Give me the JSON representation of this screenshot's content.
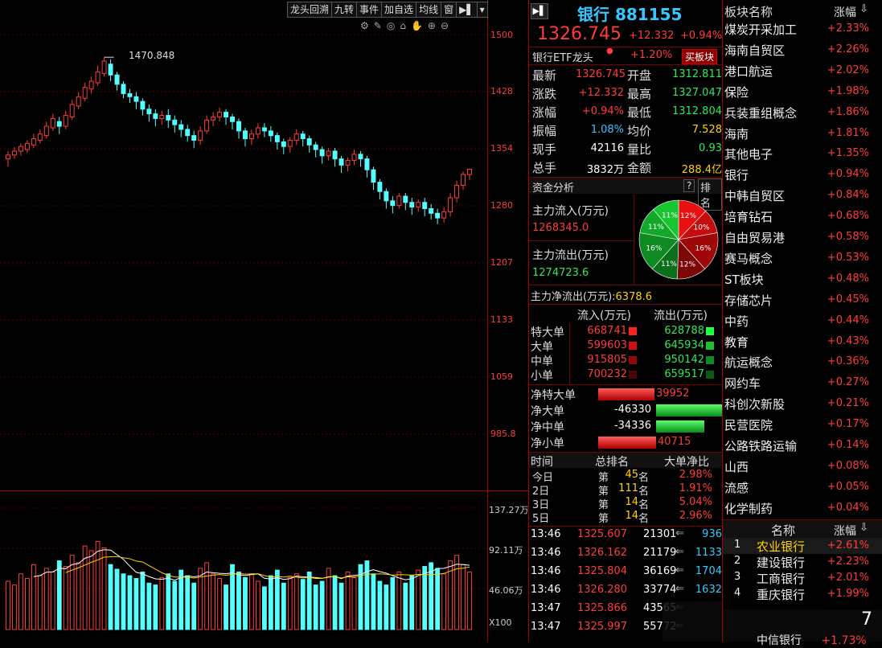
{
  "toolbar": {
    "items": [
      "龙头回溯",
      "九转",
      "事件",
      "加自选",
      "均线",
      "窗"
    ]
  },
  "chart": {
    "peak_label": "1470.848",
    "price_ticks": [
      "1500",
      "1428",
      "1354",
      "1280",
      "1207",
      "1133",
      "1059",
      "985.8"
    ],
    "volume_ticks": [
      "137.27万",
      "92.11万",
      "46.06万"
    ],
    "volume_unit": "X100"
  },
  "chart_data": {
    "type": "candlestick",
    "ylim": [
      985.8,
      1500
    ],
    "candles": [
      [
        1340,
        1345,
        1330,
        1350
      ],
      [
        1345,
        1350,
        1340,
        1355
      ],
      [
        1350,
        1356,
        1344,
        1360
      ],
      [
        1352,
        1360,
        1348,
        1364
      ],
      [
        1358,
        1366,
        1354,
        1372
      ],
      [
        1364,
        1372,
        1360,
        1378
      ],
      [
        1370,
        1382,
        1366,
        1388
      ],
      [
        1380,
        1392,
        1376,
        1398
      ],
      [
        1388,
        1382,
        1372,
        1394
      ],
      [
        1382,
        1396,
        1378,
        1402
      ],
      [
        1394,
        1410,
        1390,
        1416
      ],
      [
        1408,
        1420,
        1404,
        1426
      ],
      [
        1418,
        1432,
        1414,
        1438
      ],
      [
        1430,
        1440,
        1424,
        1446
      ],
      [
        1438,
        1452,
        1434,
        1460
      ],
      [
        1450,
        1466,
        1446,
        1470.848
      ],
      [
        1462,
        1448,
        1440,
        1468
      ],
      [
        1448,
        1436,
        1428,
        1452
      ],
      [
        1436,
        1424,
        1418,
        1440
      ],
      [
        1424,
        1420,
        1412,
        1430
      ],
      [
        1420,
        1414,
        1404,
        1426
      ],
      [
        1414,
        1404,
        1396,
        1418
      ],
      [
        1404,
        1398,
        1388,
        1410
      ],
      [
        1398,
        1392,
        1382,
        1404
      ],
      [
        1392,
        1396,
        1384,
        1402
      ],
      [
        1396,
        1390,
        1380,
        1404
      ],
      [
        1390,
        1384,
        1374,
        1396
      ],
      [
        1384,
        1378,
        1368,
        1390
      ],
      [
        1378,
        1370,
        1362,
        1384
      ],
      [
        1370,
        1364,
        1354,
        1376
      ],
      [
        1364,
        1376,
        1358,
        1382
      ],
      [
        1376,
        1390,
        1372,
        1396
      ],
      [
        1390,
        1394,
        1382,
        1400
      ],
      [
        1394,
        1400,
        1388,
        1406
      ],
      [
        1400,
        1394,
        1384,
        1404
      ],
      [
        1394,
        1388,
        1378,
        1398
      ],
      [
        1388,
        1376,
        1366,
        1392
      ],
      [
        1376,
        1366,
        1356,
        1380
      ],
      [
        1366,
        1372,
        1358,
        1378
      ],
      [
        1372,
        1380,
        1366,
        1386
      ],
      [
        1380,
        1376,
        1368,
        1386
      ],
      [
        1376,
        1370,
        1362,
        1382
      ],
      [
        1370,
        1362,
        1352,
        1374
      ],
      [
        1362,
        1356,
        1346,
        1366
      ],
      [
        1356,
        1364,
        1348,
        1368
      ],
      [
        1364,
        1372,
        1358,
        1378
      ],
      [
        1372,
        1366,
        1356,
        1376
      ],
      [
        1366,
        1358,
        1348,
        1370
      ],
      [
        1358,
        1352,
        1342,
        1362
      ],
      [
        1352,
        1344,
        1334,
        1356
      ],
      [
        1344,
        1350,
        1338,
        1354
      ],
      [
        1350,
        1340,
        1330,
        1354
      ],
      [
        1340,
        1332,
        1322,
        1344
      ],
      [
        1332,
        1338,
        1324,
        1342
      ],
      [
        1338,
        1346,
        1332,
        1352
      ],
      [
        1346,
        1340,
        1330,
        1350
      ],
      [
        1340,
        1326,
        1316,
        1344
      ],
      [
        1326,
        1310,
        1300,
        1330
      ],
      [
        1310,
        1298,
        1288,
        1314
      ],
      [
        1298,
        1286,
        1276,
        1302
      ],
      [
        1286,
        1280,
        1270,
        1292
      ],
      [
        1280,
        1292,
        1276,
        1296
      ],
      [
        1292,
        1284,
        1274,
        1296
      ],
      [
        1284,
        1278,
        1268,
        1290
      ],
      [
        1278,
        1284,
        1272,
        1288
      ],
      [
        1284,
        1276,
        1266,
        1290
      ],
      [
        1276,
        1270,
        1262,
        1282
      ],
      [
        1270,
        1264,
        1256,
        1276
      ],
      [
        1264,
        1272,
        1258,
        1278
      ],
      [
        1272,
        1290,
        1266,
        1296
      ],
      [
        1290,
        1306,
        1284,
        1312
      ],
      [
        1306,
        1320,
        1300,
        1324
      ],
      [
        1320,
        1326.745,
        1312.804,
        1327.047
      ]
    ],
    "volumes": [
      52,
      48,
      60,
      55,
      70,
      58,
      66,
      62,
      74,
      68,
      80,
      72,
      90,
      85,
      95,
      88,
      70,
      65,
      60,
      58,
      55,
      62,
      50,
      48,
      56,
      60,
      52,
      64,
      58,
      50,
      66,
      72,
      60,
      55,
      48,
      70,
      62,
      56,
      60,
      52,
      46,
      58,
      64,
      50,
      56,
      60,
      54,
      62,
      48,
      52,
      66,
      58,
      50,
      62,
      56,
      70,
      74,
      60,
      52,
      48,
      56,
      62,
      50,
      58,
      64,
      68,
      72,
      66,
      60,
      74,
      80,
      70,
      62
    ]
  },
  "quote": {
    "title": "银行 881155",
    "price": "1326.745",
    "change": "+12.332",
    "change_pct": "+0.94%",
    "etf_label": "银行ETF龙头",
    "etf_pct": "+1.20%",
    "buy_btn": "买板块",
    "fields": [
      {
        "l1": "最新",
        "v1": "1326.745",
        "l2": "开盘",
        "v2": "1312.811"
      },
      {
        "l1": "涨跌",
        "v1": "+12.332",
        "l2": "最高",
        "v2": "1327.047"
      },
      {
        "l1": "涨幅",
        "v1": "+0.94%",
        "l2": "最低",
        "v2": "1312.804"
      },
      {
        "l1": "振幅",
        "v1": "1.08%",
        "l2": "均价",
        "v2": "7.528"
      },
      {
        "l1": "现手",
        "v1": "42116",
        "l2": "量比",
        "v2": "0.93"
      },
      {
        "l1": "总手",
        "v1": "3832万",
        "l2": "金额",
        "v2": "288.4亿"
      }
    ]
  },
  "capital": {
    "title": "资金分析",
    "help": "?",
    "rank_btn": "排名",
    "inflow_label": "主力流入(万元)",
    "inflow_value": "1268345.0",
    "outflow_label": "主力流出(万元)",
    "outflow_value": "1274723.6",
    "net_label": "主力净流出(万元):",
    "net_value": "6378.6",
    "pie": [
      {
        "label": "12%",
        "value": 12,
        "color": "#e81010"
      },
      {
        "label": "10%",
        "value": 10,
        "color": "#c40c0c"
      },
      {
        "label": "16%",
        "value": 16,
        "color": "#a00808"
      },
      {
        "label": "12%",
        "value": 12,
        "color": "#7a0606"
      },
      {
        "label": "11%",
        "value": 11,
        "color": "#0a6e1a"
      },
      {
        "label": "16%",
        "value": 16,
        "color": "#0e8a22"
      },
      {
        "label": "11%",
        "value": 11,
        "color": "#12a82a"
      },
      {
        "label": "11%",
        "value": 11,
        "color": "#18c632"
      }
    ],
    "flow_header": [
      "流入(万元)",
      "流出(万元)"
    ],
    "flows": [
      {
        "name": "特大单",
        "in": "668741",
        "out": "628788",
        "inc": "#ff2020",
        "outc": "#20ff40"
      },
      {
        "name": "大单",
        "in": "599603",
        "out": "645934",
        "inc": "#d01010",
        "outc": "#18c032"
      },
      {
        "name": "中单",
        "in": "915805",
        "out": "950142",
        "inc": "#8a0a0a",
        "outc": "#108a22"
      },
      {
        "name": "小单",
        "in": "700232",
        "out": "659517",
        "inc": "#4a0505",
        "outc": "#0a5a16"
      }
    ],
    "nets": [
      {
        "name": "净特大单",
        "value": "39952",
        "dir": "pos",
        "width": 70
      },
      {
        "name": "净大单",
        "value": "-46330",
        "dir": "neg",
        "width": 82
      },
      {
        "name": "净中单",
        "value": "-34336",
        "dir": "neg",
        "width": 60
      },
      {
        "name": "净小单",
        "value": "40715",
        "dir": "pos",
        "width": 72
      }
    ],
    "rank_header": [
      "时间",
      "总排名",
      "大单净比"
    ],
    "ranks": [
      {
        "t": "今日",
        "pre": "第",
        "n": "45",
        "suf": "名",
        "r": "2.98%"
      },
      {
        "t": "2日",
        "pre": "第",
        "n": "111",
        "suf": "名",
        "r": "1.91%"
      },
      {
        "t": "3日",
        "pre": "第",
        "n": "14",
        "suf": "名",
        "r": "5.04%"
      },
      {
        "t": "5日",
        "pre": "第",
        "n": "14",
        "suf": "名",
        "r": "2.96%"
      }
    ]
  },
  "ticks": [
    {
      "t": "13:46",
      "p": "1325.607",
      "v": "21301",
      "n": "936"
    },
    {
      "t": "13:46",
      "p": "1326.162",
      "v": "21179",
      "n": "1133"
    },
    {
      "t": "13:46",
      "p": "1325.804",
      "v": "36169",
      "n": "1704"
    },
    {
      "t": "13:46",
      "p": "1326.280",
      "v": "33774",
      "n": "1632"
    },
    {
      "t": "13:47",
      "p": "1325.866",
      "v": "43565",
      "n": ""
    },
    {
      "t": "13:47",
      "p": "1325.997",
      "v": "55772",
      "n": ""
    }
  ],
  "sectors": {
    "header_name": "板块名称",
    "header_pct": "涨幅",
    "items": [
      {
        "name": "煤炭开采加工",
        "pct": "+2.33%"
      },
      {
        "name": "海南自贸区",
        "pct": "+2.26%"
      },
      {
        "name": "港口航运",
        "pct": "+2.02%"
      },
      {
        "name": "保险",
        "pct": "+1.98%"
      },
      {
        "name": "兵装重组概念",
        "pct": "+1.86%"
      },
      {
        "name": "海南",
        "pct": "+1.81%"
      },
      {
        "name": "其他电子",
        "pct": "+1.35%"
      },
      {
        "name": "银行",
        "pct": "+0.94%"
      },
      {
        "name": "中韩自贸区",
        "pct": "+0.84%"
      },
      {
        "name": "培育钻石",
        "pct": "+0.68%"
      },
      {
        "name": "自由贸易港",
        "pct": "+0.58%"
      },
      {
        "name": "赛马概念",
        "pct": "+0.53%"
      },
      {
        "name": "ST板块",
        "pct": "+0.48%"
      },
      {
        "name": "存储芯片",
        "pct": "+0.45%"
      },
      {
        "name": "中药",
        "pct": "+0.44%"
      },
      {
        "name": "教育",
        "pct": "+0.43%"
      },
      {
        "name": "航运概念",
        "pct": "+0.36%"
      },
      {
        "name": "网约车",
        "pct": "+0.27%"
      },
      {
        "name": "科创次新股",
        "pct": "+0.21%"
      },
      {
        "name": "民营医院",
        "pct": "+0.17%"
      },
      {
        "name": "公路铁路运输",
        "pct": "+0.14%"
      },
      {
        "name": "山西",
        "pct": "+0.08%"
      },
      {
        "name": "流感",
        "pct": "+0.05%"
      },
      {
        "name": "化学制药",
        "pct": "+0.04%"
      }
    ]
  },
  "stocks": {
    "header_name": "名称",
    "header_pct": "涨幅",
    "items": [
      {
        "idx": "1",
        "name": "农业银行",
        "pct": "+2.61%"
      },
      {
        "idx": "2",
        "name": "建设银行",
        "pct": "+2.23%"
      },
      {
        "idx": "3",
        "name": "工商银行",
        "pct": "+2.01%"
      },
      {
        "idx": "4",
        "name": "重庆银行",
        "pct": "+1.99%"
      }
    ],
    "partial": {
      "idx": "7",
      "name": "中信银行",
      "pct": "+1.73%"
    }
  },
  "colors": {
    "up": "#ff3c3c",
    "down": "#2ee85a",
    "volume_up": "#ff3c3c",
    "volume_down": "#54ffff",
    "grid": "#7a0000"
  }
}
